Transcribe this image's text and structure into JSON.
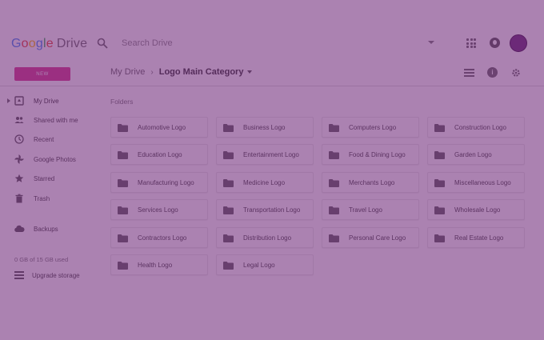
{
  "app": {
    "logo_letters": [
      "G",
      "o",
      "o",
      "g",
      "l",
      "e"
    ],
    "logo_product": "Drive"
  },
  "search": {
    "placeholder": "Search Drive"
  },
  "toolbar": {
    "new_label": "NEW"
  },
  "breadcrumb": {
    "root": "My Drive",
    "separator": "›",
    "current": "Logo Main Category"
  },
  "sidebar": {
    "items": [
      {
        "label": "My Drive",
        "icon": "drive-icon"
      },
      {
        "label": "Shared with me",
        "icon": "people-icon"
      },
      {
        "label": "Recent",
        "icon": "clock-icon"
      },
      {
        "label": "Google Photos",
        "icon": "pinwheel-icon"
      },
      {
        "label": "Starred",
        "icon": "star-icon"
      },
      {
        "label": "Trash",
        "icon": "trash-icon"
      },
      {
        "label": "Backups",
        "icon": "cloud-icon"
      }
    ],
    "storage_text": "0 GB of 15 GB used",
    "upgrade_label": "Upgrade storage"
  },
  "main": {
    "section_title": "Folders",
    "folders": [
      "Automotive Logo",
      "Business Logo",
      "Computers Logo",
      "Construction Logo",
      "Education Logo",
      "Entertainment Logo",
      "Food & Dining Logo",
      "Garden Logo",
      "Manufacturing Logo",
      "Medicine Logo",
      "Merchants Logo",
      "Miscellaneous Logo",
      "Services Logo",
      "Transportation Logo",
      "Travel Logo",
      "Wholesale Logo",
      "Contractors Logo",
      "Distribution Logo",
      "Personal Care Logo",
      "Real Estate Logo",
      "Health Logo",
      "Legal Logo"
    ]
  },
  "colors": {
    "overlay": "#6e2878",
    "new_button": "#d83a8e",
    "avatar": "#6a2b78"
  }
}
